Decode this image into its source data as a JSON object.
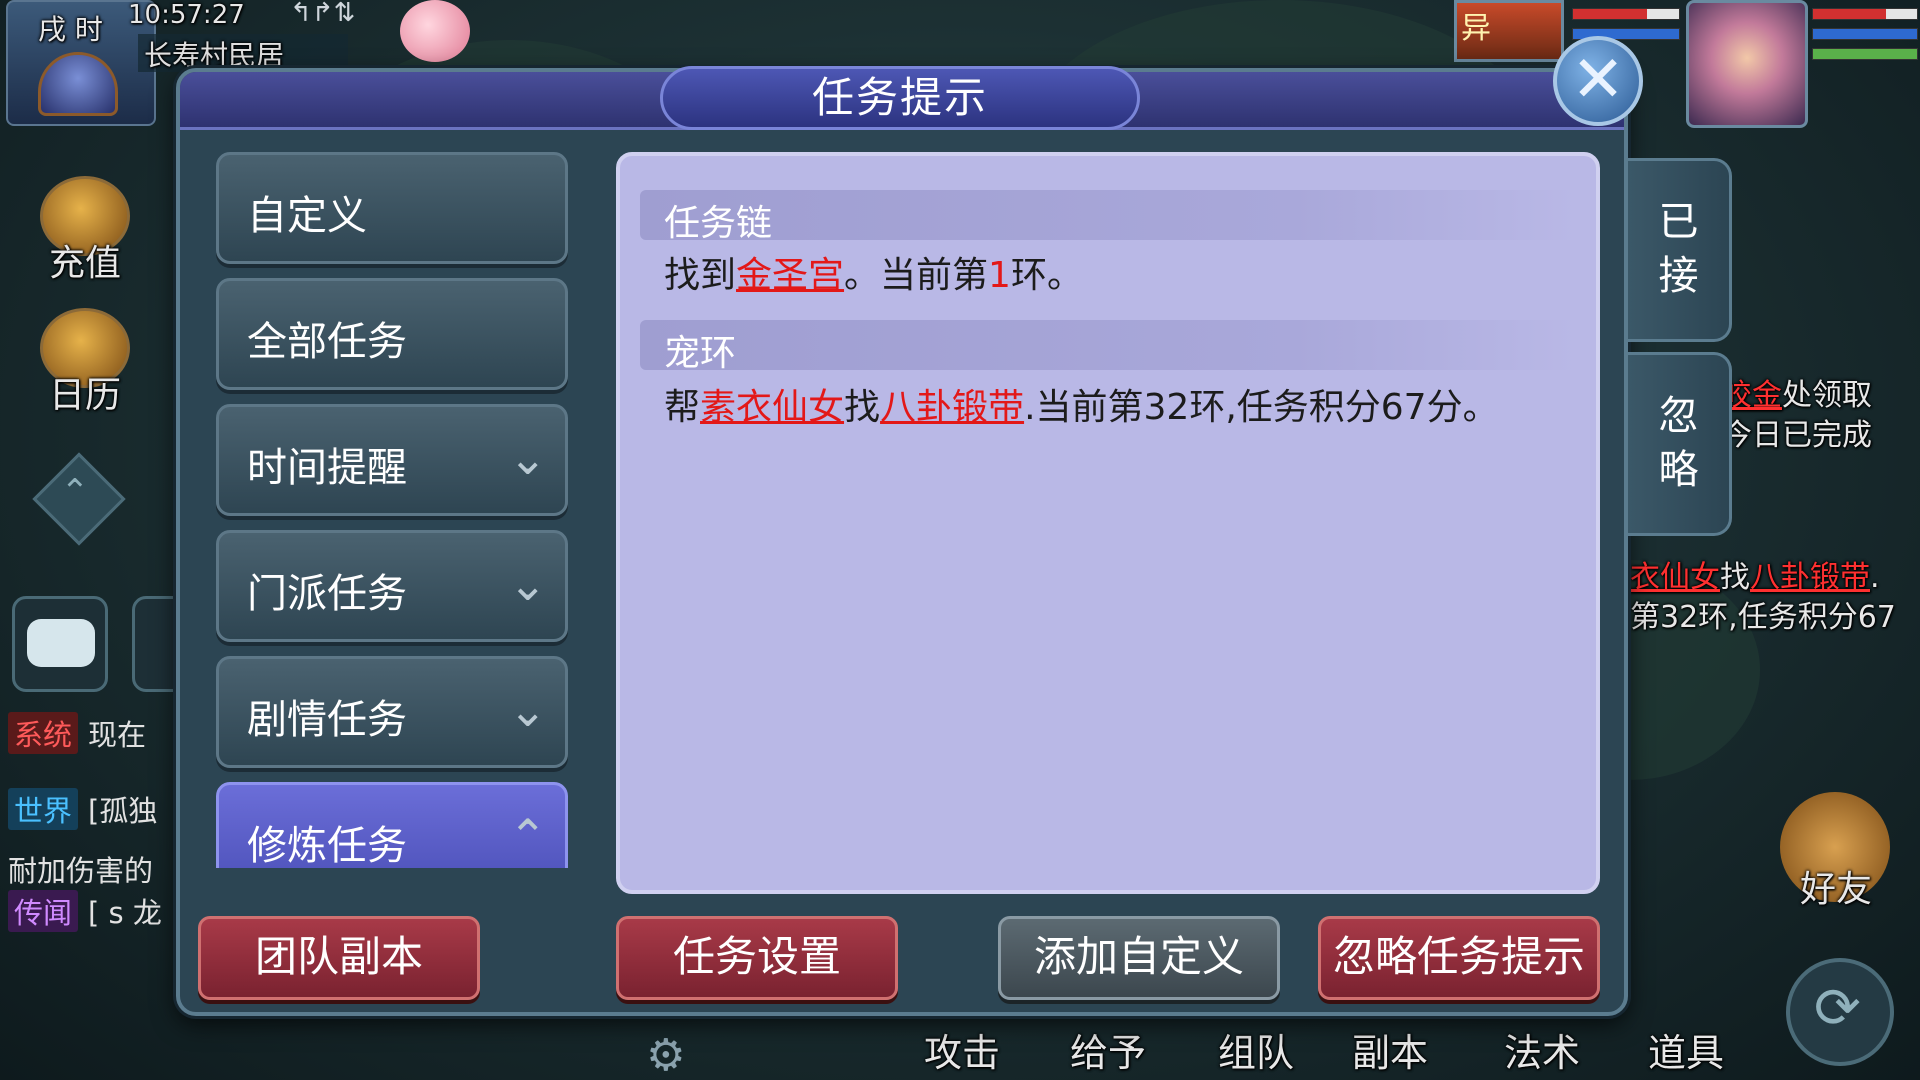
{
  "hud": {
    "shichen": "戌 时",
    "time": "10:57:27",
    "net_arrows": "↰↱⇅",
    "location": "长寿村民居",
    "left_icons": {
      "recharge": "充值",
      "calendar": "日历"
    },
    "chat": [
      {
        "channel": "系统",
        "channel_color": "#c0392b",
        "text": "现在"
      },
      {
        "channel": "世界",
        "channel_color": "#2e9ad0",
        "text": "[孤独"
      },
      {
        "channel": "",
        "channel_color": "",
        "text": "耐加伤害的"
      },
      {
        "channel": "传闻",
        "channel_color": "#8e44ad",
        "text": "[ s 龙"
      }
    ],
    "pet_badge": "异",
    "right_texts": {
      "line1_red": "皎金",
      "line1_rest": "处领取",
      "line2": "今日已完成",
      "line3_red1": "衣仙女",
      "line3_mid": "找",
      "line3_red2": "八卦锻带",
      "line3_end": ".",
      "line4": "第32环,任务积分67"
    },
    "friend_label": "好友",
    "bottom_bar": [
      "攻击",
      "给予",
      "组队",
      "副本",
      "法术",
      "道具"
    ]
  },
  "dialog": {
    "title": "任务提示",
    "close_symbol": "✕",
    "tabs": [
      {
        "label": "自定义",
        "chevron": ""
      },
      {
        "label": "全部任务",
        "chevron": ""
      },
      {
        "label": "时间提醒",
        "chevron": "⌄"
      },
      {
        "label": "门派任务",
        "chevron": "⌄"
      },
      {
        "label": "剧情任务",
        "chevron": "⌄"
      },
      {
        "label": "修炼任务",
        "chevron": "⌃"
      }
    ],
    "sections": [
      {
        "header": "任务链",
        "parts": [
          "找到",
          "金圣宫",
          "。当前第",
          "1",
          "环。"
        ]
      },
      {
        "header": "宠环",
        "parts": [
          "帮",
          "素衣仙女",
          "找",
          "八卦锻带",
          ".当前第32环,任务积分67分。"
        ]
      }
    ],
    "side_tabs": [
      {
        "chars": [
          "已",
          "接"
        ]
      },
      {
        "chars": [
          "忽",
          "略"
        ]
      }
    ],
    "buttons": {
      "team_dungeon": "团队副本",
      "task_settings": "任务设置",
      "add_custom": "添加自定义",
      "ignore_hint": "忽略任务提示"
    }
  }
}
